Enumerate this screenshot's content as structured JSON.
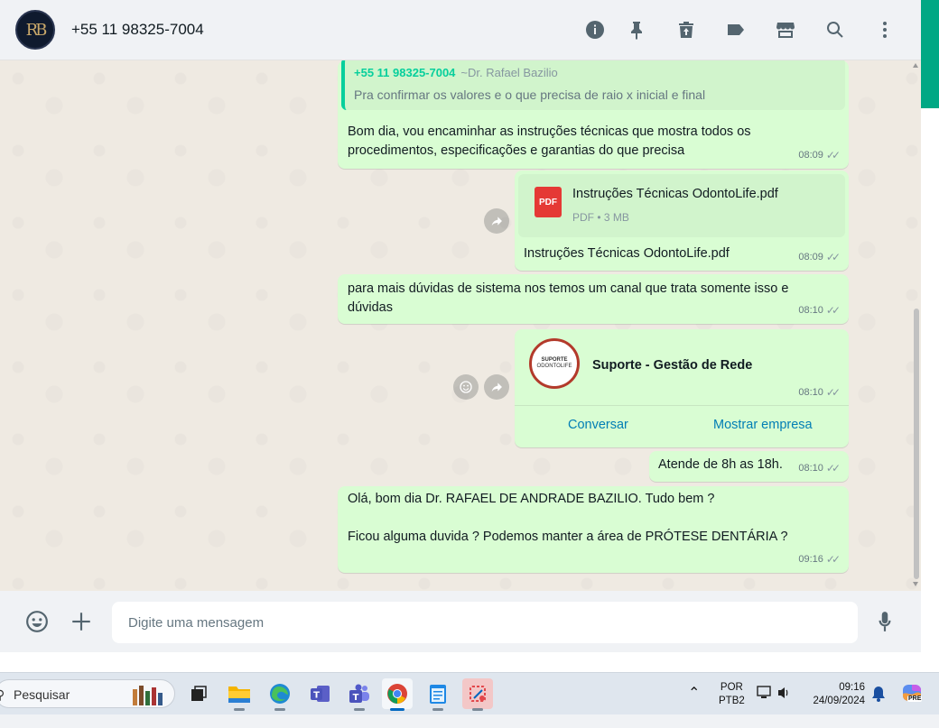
{
  "header": {
    "avatar_text": "RB",
    "contact_name": "+55 11 98325-7004"
  },
  "messages": {
    "m1": {
      "quote_author": "+55 11 98325-7004",
      "quote_subtitle": "~Dr. Rafael Bazilio",
      "quote_text": "Pra confirmar os valores e o que precisa de raio x inicial e final",
      "line1": "Bom dia, vou encaminhar as instruções técnicas que mostra todos os",
      "line2": "procedimentos, especificações e garantias do que precisa",
      "time": "08:09"
    },
    "m2": {
      "pdf_label": "PDF",
      "doc_name": "Instruções Técnicas OdontoLife.pdf",
      "doc_meta": "PDF • 3 MB",
      "caption": "Instruções Técnicas OdontoLife.pdf",
      "time": "08:09"
    },
    "m3": {
      "line1": "para mais dúvidas de sistema nos temos um canal que trata somente isso e",
      "line2": "dúvidas",
      "time": "08:10"
    },
    "m4": {
      "logo_line1": "SUPORTE",
      "logo_line2": "ODONTOLIFE",
      "name": "Suporte - Gestão de Rede",
      "time": "08:10",
      "action1": "Conversar",
      "action2": "Mostrar empresa"
    },
    "m5": {
      "text": "Atende de 8h as 18h.",
      "time": "08:10"
    },
    "m6": {
      "line1": "Olá, bom dia  Dr.  RAFAEL DE ANDRADE BAZILIO. Tudo bem ?",
      "line2": "Ficou alguma duvida ? Podemos manter a área de PRÓTESE DENTÁRIA ?",
      "time": "09:16"
    }
  },
  "composer": {
    "placeholder": "Digite uma mensagem"
  },
  "taskbar": {
    "search_placeholder": "Pesquisar",
    "lang_line1": "POR",
    "lang_line2": "PTB2",
    "clock_time": "09:16",
    "clock_date": "24/09/2024",
    "copilot_badge": "PRE"
  },
  "colors": {
    "bubble_out": "#d9fdd3",
    "chat_bg": "#efeae2",
    "accent": "#00a884",
    "link": "#027eb5"
  }
}
